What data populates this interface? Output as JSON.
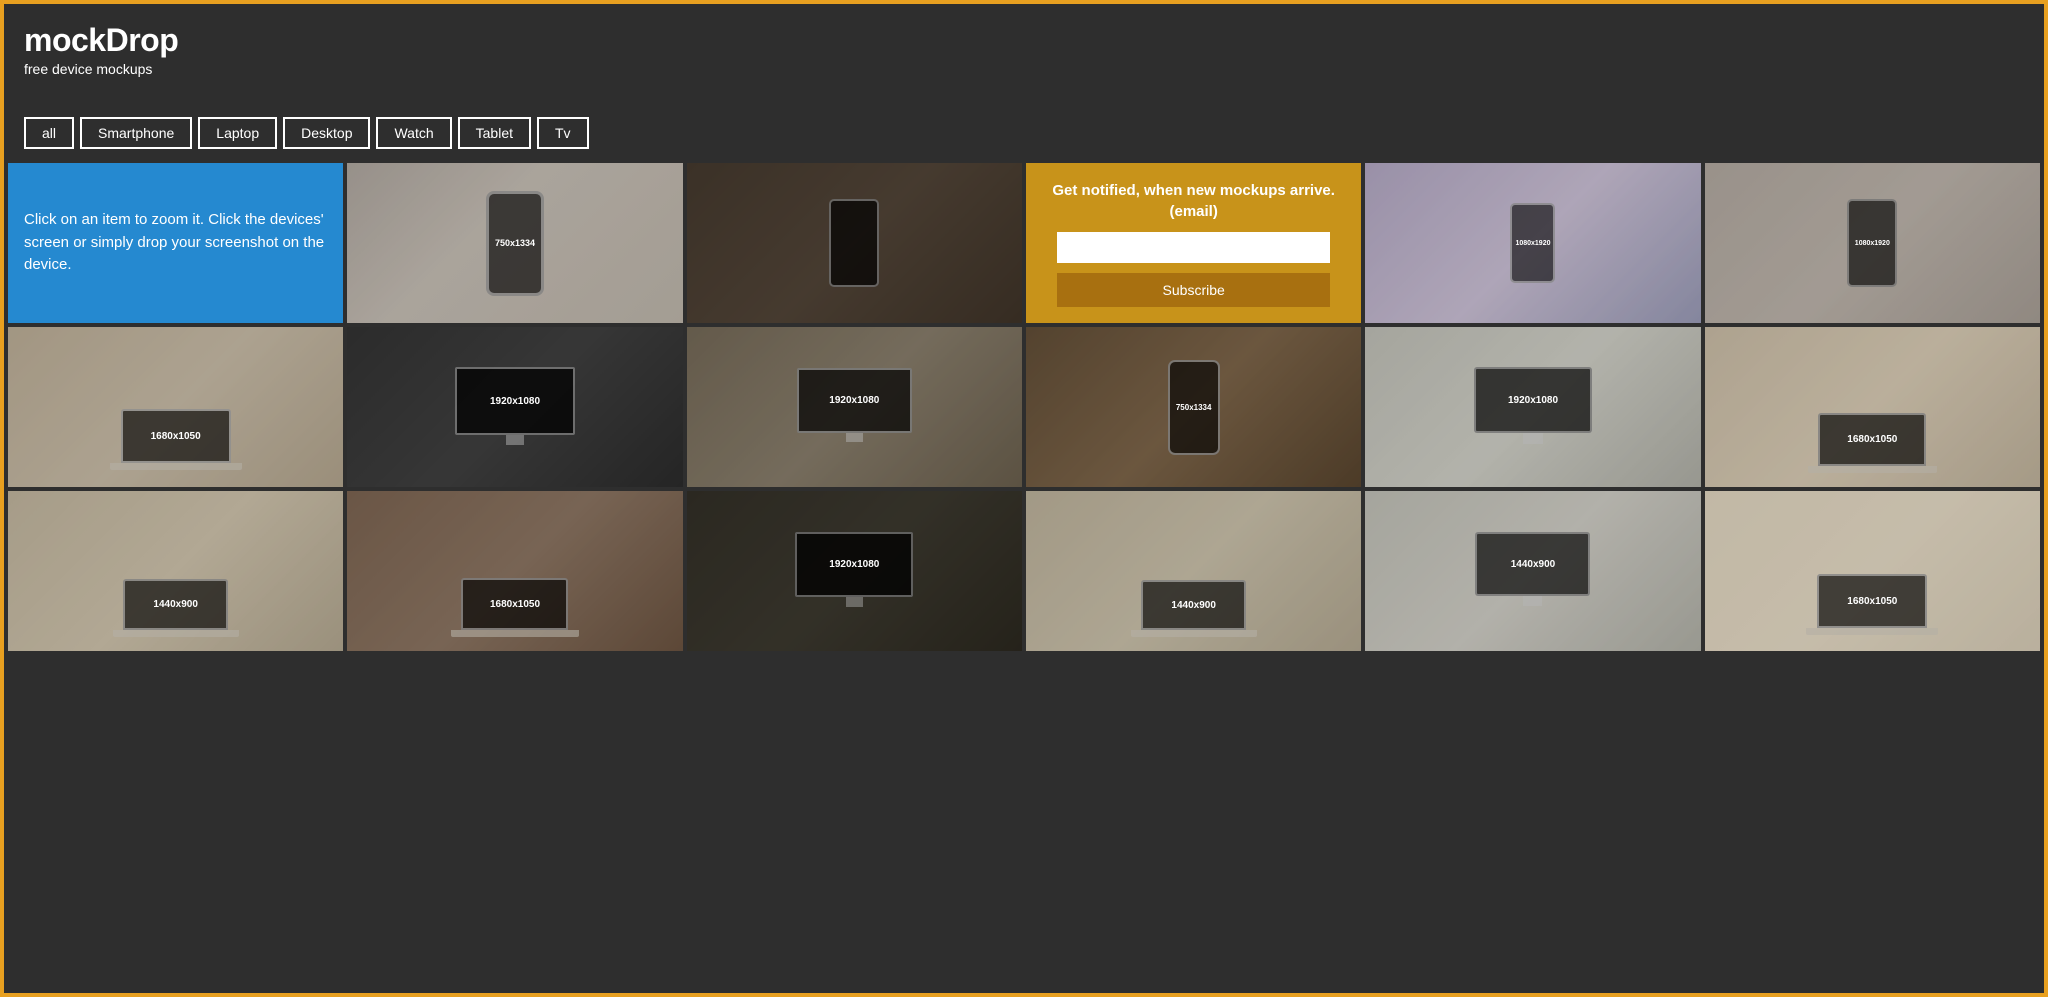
{
  "header": {
    "logo": "mockDrop",
    "tagline": "free device mockups"
  },
  "filters": {
    "buttons": [
      "all",
      "Smartphone",
      "Laptop",
      "Desktop",
      "Watch",
      "Tablet",
      "Tv"
    ],
    "active": "all"
  },
  "info_tile": {
    "text": "Click on an item to zoom it. Click the devices' screen or simply drop your screenshot on the device."
  },
  "newsletter_tile": {
    "heading": "Get notified, when new mockups arrive. (email)",
    "placeholder": "",
    "button_label": "Subscribe"
  },
  "grid_tiles": [
    {
      "id": "t1",
      "type": "photo",
      "css": "pt-hand-phone",
      "label": "750x1334",
      "has_device": true,
      "device": "phone"
    },
    {
      "id": "t2",
      "type": "photo",
      "css": "pt-desk-dark",
      "label": "",
      "has_device": false
    },
    {
      "id": "t3",
      "type": "photo",
      "css": "pt-hands-vr",
      "label": "1080x1920",
      "has_device": true,
      "device": "phone-side"
    },
    {
      "id": "t4",
      "type": "photo",
      "css": "pt-hand-book",
      "label": "1080x1920",
      "has_device": false
    },
    {
      "id": "t5",
      "type": "photo",
      "css": "pt-laptop-desk",
      "label": "1680x1050",
      "has_device": true,
      "device": "laptop"
    },
    {
      "id": "t6",
      "type": "photo",
      "css": "pt-monitor-dark",
      "label": "1920x1080",
      "has_device": true,
      "device": "monitor"
    },
    {
      "id": "t7",
      "type": "photo",
      "css": "pt-monitor-desk",
      "label": "1920x1080",
      "has_device": true,
      "device": "monitor"
    },
    {
      "id": "t8",
      "type": "photo",
      "css": "pt-phone-coffee",
      "label": "750x1334",
      "has_device": true,
      "device": "phone"
    },
    {
      "id": "t9",
      "type": "photo",
      "css": "pt-imac-books",
      "label": "1920x1080",
      "has_device": true,
      "device": "monitor"
    },
    {
      "id": "t10",
      "type": "photo",
      "css": "pt-man-desk",
      "label": "1680x1050",
      "has_device": true,
      "device": "laptop"
    },
    {
      "id": "t11",
      "type": "photo",
      "css": "pt-laptop-notebook",
      "label": "1440x900",
      "has_device": true,
      "device": "laptop"
    },
    {
      "id": "t12",
      "type": "photo",
      "css": "pt-laptop-couch",
      "label": "1680x1050",
      "has_device": true,
      "device": "laptop"
    },
    {
      "id": "t13",
      "type": "photo",
      "css": "pt-monitor-dark2",
      "label": "1920x1080",
      "has_device": true,
      "device": "monitor"
    },
    {
      "id": "t14",
      "type": "photo",
      "css": "pt-desk-window",
      "label": "1440x900",
      "has_device": true,
      "device": "laptop"
    },
    {
      "id": "t15",
      "type": "photo",
      "css": "pt-imac-desk2",
      "label": "1440x900",
      "has_device": true,
      "device": "monitor"
    },
    {
      "id": "t16",
      "type": "photo",
      "css": "pt-man-laptop",
      "label": "1680x1050",
      "has_device": true,
      "device": "laptop"
    }
  ],
  "colors": {
    "bg": "#2e2e2e",
    "border": "#e8a020",
    "blue_tile": "#2589d0",
    "gold_tile": "#c8931a",
    "subscribe_btn": "#a87010"
  }
}
